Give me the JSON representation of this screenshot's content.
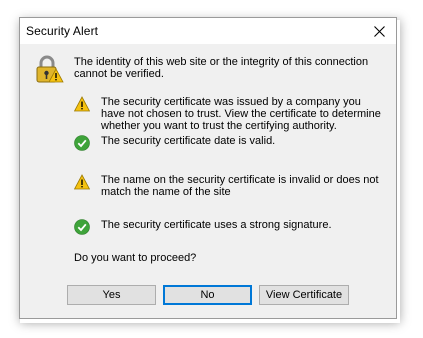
{
  "window": {
    "title": "Security Alert",
    "close_icon": "close-icon"
  },
  "intro": "The identity of this web site or the integrity of this connection cannot be verified.",
  "items": [
    {
      "status": "warning",
      "icon": "warning-icon",
      "text": "The security certificate was issued by a company you have not chosen to trust. View the certificate to determine whether you want to trust the certifying authority."
    },
    {
      "status": "ok",
      "icon": "check-icon",
      "text": "The security certificate date is valid."
    },
    {
      "status": "warning",
      "icon": "warning-icon",
      "text": "The name on the security certificate is invalid or does not match the name of the site"
    },
    {
      "status": "ok",
      "icon": "check-icon",
      "text": "The security certificate uses a strong signature."
    }
  ],
  "question": "Do you want to proceed?",
  "buttons": {
    "yes": "Yes",
    "no": "No",
    "view_certificate": "View Certificate"
  },
  "colors": {
    "warning": "#f5c211",
    "ok": "#3ea33a",
    "focus": "#0078d7"
  }
}
